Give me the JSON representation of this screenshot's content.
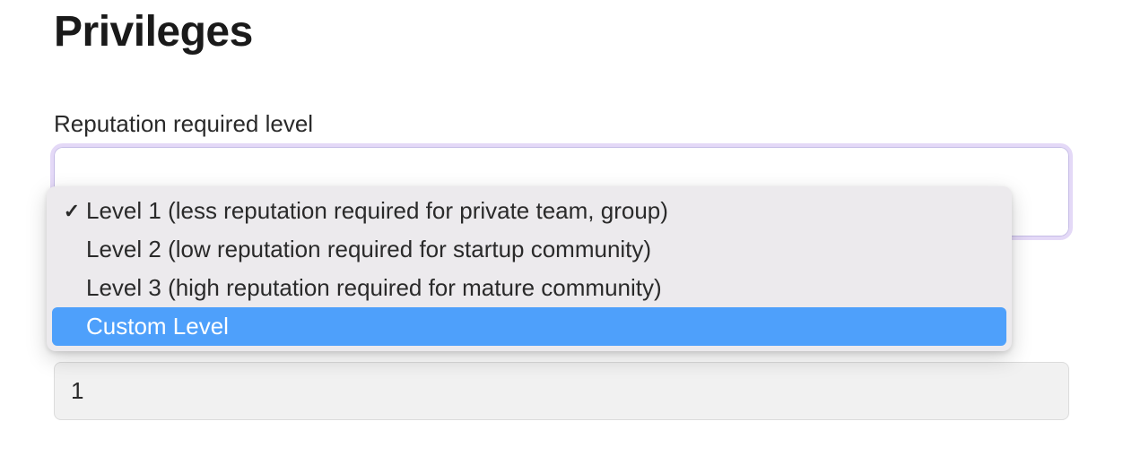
{
  "page": {
    "title": "Privileges"
  },
  "field": {
    "label": "Reputation required level"
  },
  "dropdown": {
    "options": [
      {
        "label": "Level 1 (less reputation required for private team, group)",
        "selected": true,
        "highlighted": false
      },
      {
        "label": "Level 2 (low reputation required for startup community)",
        "selected": false,
        "highlighted": false
      },
      {
        "label": "Level 3 (high reputation required for mature community)",
        "selected": false,
        "highlighted": false
      },
      {
        "label": "Custom Level",
        "selected": false,
        "highlighted": true
      }
    ]
  },
  "value_input": {
    "value": "1"
  },
  "checkmark_glyph": "✓"
}
